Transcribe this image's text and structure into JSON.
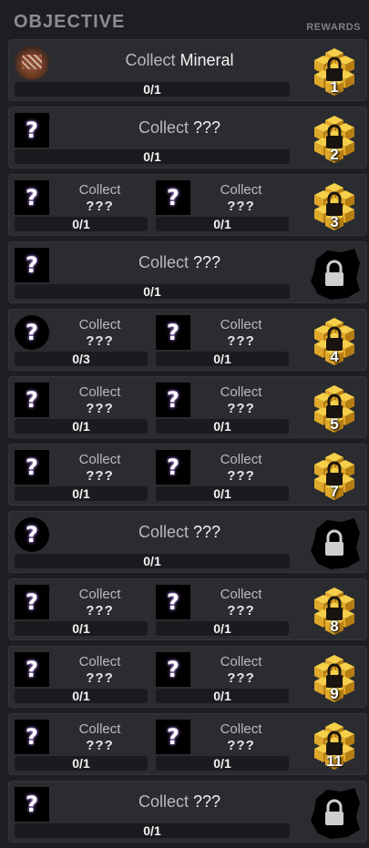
{
  "header": {
    "title": "OBJECTIVE",
    "rewards_label": "REWARDS"
  },
  "colors": {
    "background": "#1d1e21",
    "row": "#2b2c30",
    "bar": "#1a1b1e",
    "reward_gold": "#e0a82a",
    "question_glow": "#a67fe0"
  },
  "rows": [
    {
      "layout": "single",
      "items": [
        {
          "icon": "mineral-icon",
          "label": "Collect",
          "name": "Mineral",
          "progress": "0/1",
          "fraction": 0
        }
      ],
      "reward": {
        "type": "gold-cube",
        "number": "1"
      }
    },
    {
      "layout": "single",
      "items": [
        {
          "icon": "question-icon",
          "label": "Collect",
          "name": "???",
          "progress": "0/1",
          "fraction": 0
        }
      ],
      "reward": {
        "type": "gold-cube",
        "number": "2"
      }
    },
    {
      "layout": "double",
      "items": [
        {
          "icon": "question-icon",
          "label": "Collect",
          "name": "???",
          "progress": "0/1",
          "fraction": 0
        },
        {
          "icon": "question-icon",
          "label": "Collect",
          "name": "???",
          "progress": "0/1",
          "fraction": 0
        }
      ],
      "reward": {
        "type": "gold-cube",
        "number": "3"
      }
    },
    {
      "layout": "single",
      "items": [
        {
          "icon": "question-icon",
          "label": "Collect",
          "name": "???",
          "progress": "0/1",
          "fraction": 0
        }
      ],
      "reward": {
        "type": "locked",
        "number": ""
      }
    },
    {
      "layout": "double",
      "items": [
        {
          "icon": "question-icon",
          "round": true,
          "label": "Collect",
          "name": "???",
          "progress": "0/3",
          "fraction": 0
        },
        {
          "icon": "question-icon",
          "label": "Collect",
          "name": "???",
          "progress": "0/1",
          "fraction": 0
        }
      ],
      "reward": {
        "type": "gold-cube",
        "number": "4"
      }
    },
    {
      "layout": "double",
      "items": [
        {
          "icon": "question-icon",
          "label": "Collect",
          "name": "???",
          "progress": "0/1",
          "fraction": 0
        },
        {
          "icon": "question-icon",
          "label": "Collect",
          "name": "???",
          "progress": "0/1",
          "fraction": 0
        }
      ],
      "reward": {
        "type": "gold-cube",
        "number": "5"
      }
    },
    {
      "layout": "double",
      "items": [
        {
          "icon": "question-icon",
          "label": "Collect",
          "name": "???",
          "progress": "0/1",
          "fraction": 0
        },
        {
          "icon": "question-icon",
          "label": "Collect",
          "name": "???",
          "progress": "0/1",
          "fraction": 0
        }
      ],
      "reward": {
        "type": "gold-cube",
        "number": "7"
      }
    },
    {
      "layout": "single",
      "items": [
        {
          "icon": "question-icon",
          "round": true,
          "label": "Collect",
          "name": "???",
          "progress": "0/1",
          "fraction": 0
        }
      ],
      "reward": {
        "type": "locked",
        "number": ""
      }
    },
    {
      "layout": "double",
      "items": [
        {
          "icon": "question-icon",
          "label": "Collect",
          "name": "???",
          "progress": "0/1",
          "fraction": 0
        },
        {
          "icon": "question-icon",
          "label": "Collect",
          "name": "???",
          "progress": "0/1",
          "fraction": 0
        }
      ],
      "reward": {
        "type": "gold-cube",
        "number": "8"
      }
    },
    {
      "layout": "double",
      "items": [
        {
          "icon": "question-icon",
          "label": "Collect",
          "name": "???",
          "progress": "0/1",
          "fraction": 0
        },
        {
          "icon": "question-icon",
          "label": "Collect",
          "name": "???",
          "progress": "0/1",
          "fraction": 0
        }
      ],
      "reward": {
        "type": "gold-cube",
        "number": "9"
      }
    },
    {
      "layout": "double",
      "items": [
        {
          "icon": "question-icon",
          "label": "Collect",
          "name": "???",
          "progress": "0/1",
          "fraction": 0
        },
        {
          "icon": "question-icon",
          "label": "Collect",
          "name": "???",
          "progress": "0/1",
          "fraction": 0
        }
      ],
      "reward": {
        "type": "gold-cube",
        "number": "11"
      }
    },
    {
      "layout": "single",
      "items": [
        {
          "icon": "question-icon",
          "label": "Collect",
          "name": "???",
          "progress": "0/1",
          "fraction": 0
        }
      ],
      "reward": {
        "type": "locked",
        "number": ""
      }
    }
  ]
}
